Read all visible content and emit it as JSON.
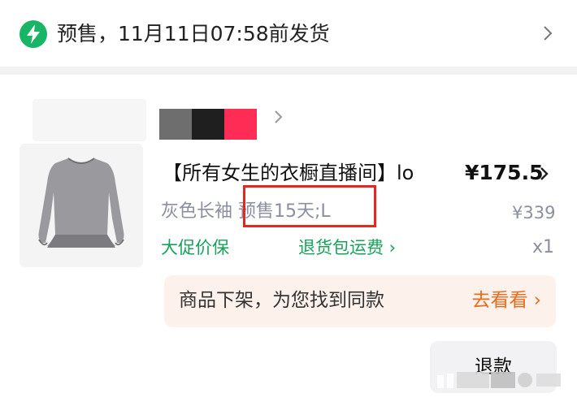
{
  "banner": {
    "icon": "lightning-icon",
    "text": "预售，11月11日07:58前发货"
  },
  "order": {
    "shop_blur_colors": [
      "#6e6e6e",
      "#1f1f1f",
      "#ff2d55"
    ],
    "product": {
      "title": "【所有女生的衣橱直播间】lo",
      "price": "¥175.5",
      "spec": "灰色长袖 预售15天;L",
      "original_price": "¥339",
      "promo_tag": "大促价保",
      "return_shipping": "退货包运费 ›",
      "quantity": "x1"
    },
    "notice": {
      "text": "商品下架，为您找到同款",
      "link": "去看看 ›"
    },
    "refund_button": "退款"
  },
  "colors": {
    "green": "#18b566",
    "highlight_box": "#e52621",
    "notice_link": "#ec6a1a"
  }
}
